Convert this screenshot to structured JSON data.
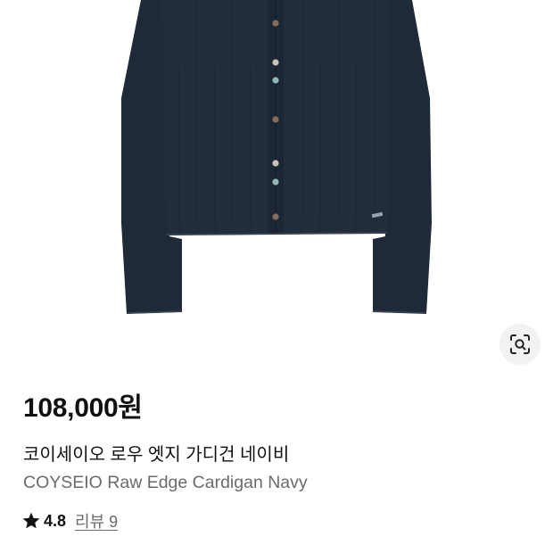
{
  "product": {
    "price": "108,000원",
    "name_ko": "코이세이오 로우 엣지 가디건 네이비",
    "name_en": "COYSEIO Raw Edge Cardigan Navy",
    "rating": "4.8",
    "review_link": "리뷰 9"
  },
  "icons": {
    "lens": "image-search-icon",
    "star": "star-icon"
  },
  "colors": {
    "garment": "#1f2a38",
    "text_primary": "#111111",
    "text_secondary": "#6b6b6b",
    "lens_bg": "#f2f2f2"
  }
}
